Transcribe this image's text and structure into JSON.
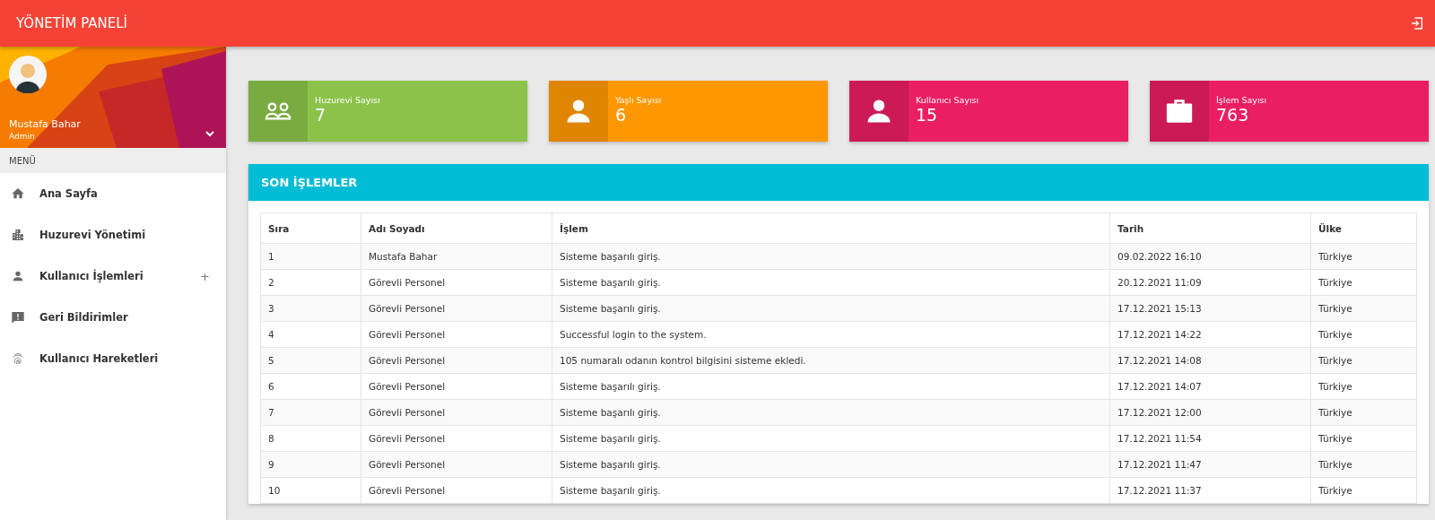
{
  "header": {
    "title": "YÖNETİM PANELİ"
  },
  "sidebar": {
    "user": {
      "name": "Mustafa Bahar",
      "role": "Admin"
    },
    "menu_label": "MENÜ",
    "items": [
      {
        "label": "Ana Sayfa"
      },
      {
        "label": "Huzurevi Yönetimi"
      },
      {
        "label": "Kullanıcı İşlemleri",
        "expander": "+"
      },
      {
        "label": "Geri Bildirimler"
      },
      {
        "label": "Kullanıcı Hareketleri"
      }
    ]
  },
  "cards": [
    {
      "label": "Huzurevi Sayısı",
      "value": "7",
      "color": "#8bc34a"
    },
    {
      "label": "Yaşlı Sayısı",
      "value": "6",
      "color": "#ff9800"
    },
    {
      "label": "Kullanıcı Sayısı",
      "value": "15",
      "color": "#e91e63"
    },
    {
      "label": "İşlem Sayısı",
      "value": "763",
      "color": "#e91e63"
    }
  ],
  "panel": {
    "title": "SON İŞLEMLER",
    "columns": [
      "Sıra",
      "Adı Soyadı",
      "İşlem",
      "Tarih",
      "Ülke"
    ],
    "rows": [
      [
        "1",
        "Mustafa Bahar",
        "Sisteme başarılı giriş.",
        "09.02.2022 16:10",
        "Türkiye"
      ],
      [
        "2",
        "Görevli Personel",
        "Sisteme başarılı giriş.",
        "20.12.2021 11:09",
        "Türkiye"
      ],
      [
        "3",
        "Görevli Personel",
        "Sisteme başarılı giriş.",
        "17.12.2021 15:13",
        "Türkiye"
      ],
      [
        "4",
        "Görevli Personel",
        "Successful login to the system.",
        "17.12.2021 14:22",
        "Türkiye"
      ],
      [
        "5",
        "Görevli Personel",
        "105 numaralı odanın kontrol bilgisini sisteme ekledi.",
        "17.12.2021 14:08",
        "Türkiye"
      ],
      [
        "6",
        "Görevli Personel",
        "Sisteme başarılı giriş.",
        "17.12.2021 14:07",
        "Türkiye"
      ],
      [
        "7",
        "Görevli Personel",
        "Sisteme başarılı giriş.",
        "17.12.2021 12:00",
        "Türkiye"
      ],
      [
        "8",
        "Görevli Personel",
        "Sisteme başarılı giriş.",
        "17.12.2021 11:54",
        "Türkiye"
      ],
      [
        "9",
        "Görevli Personel",
        "Sisteme başarılı giriş.",
        "17.12.2021 11:47",
        "Türkiye"
      ],
      [
        "10",
        "Görevli Personel",
        "Sisteme başarılı giriş.",
        "17.12.2021 11:37",
        "Türkiye"
      ]
    ]
  }
}
